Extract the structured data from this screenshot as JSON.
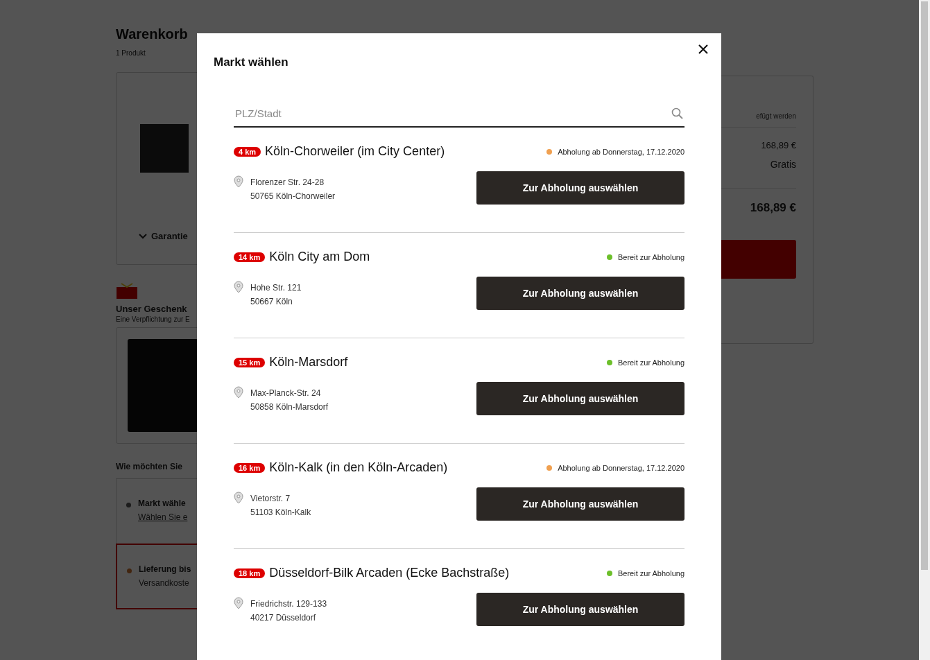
{
  "page": {
    "title": "Warenkorb",
    "subtitle": "1 Produkt",
    "warranty_toggle": "Garantie",
    "gift_title": "Unser Geschenk",
    "gift_text": "Eine Verpflichtung zur E",
    "delivery_heading": "Wie möchten Sie",
    "delivery_options": [
      {
        "title": "Markt wähle",
        "subtitle": "Wählen Sie e",
        "selected": false
      },
      {
        "title": "Lieferung bis",
        "subtitle": "Versandkoste",
        "selected": true
      }
    ],
    "summary": {
      "note": "efügt werden",
      "subtotal": "168,89 €",
      "shipping": "Gratis",
      "total": "168,89 €"
    }
  },
  "modal": {
    "title": "Markt wählen",
    "search": {
      "placeholder": "PLZ/Stadt"
    },
    "stores": [
      {
        "distance": "4 km",
        "name": "Köln-Chorweiler (im City Center)",
        "status": "Abholung ab Donnerstag, 17.12.2020",
        "color": "#f0a050",
        "street": "Florenzer Str. 24-28",
        "city": "50765 Köln-Chorweiler",
        "button": "Zur Abholung auswählen"
      },
      {
        "distance": "14 km",
        "name": "Köln City am Dom",
        "status": "Bereit zur Abholung",
        "color": "#6cbf2a",
        "street": "Hohe Str. 121",
        "city": "50667 Köln",
        "button": "Zur Abholung auswählen"
      },
      {
        "distance": "15 km",
        "name": "Köln-Marsdorf",
        "status": "Bereit zur Abholung",
        "color": "#6cbf2a",
        "street": "Max-Planck-Str. 24",
        "city": "50858 Köln-Marsdorf",
        "button": "Zur Abholung auswählen"
      },
      {
        "distance": "16 km",
        "name": "Köln-Kalk (in den Köln-Arcaden)",
        "status": "Abholung ab Donnerstag, 17.12.2020",
        "color": "#f0a050",
        "street": "Vietorstr. 7",
        "city": "51103 Köln-Kalk",
        "button": "Zur Abholung auswählen"
      },
      {
        "distance": "18 km",
        "name": "Düsseldorf-Bilk Arcaden (Ecke Bachstraße)",
        "status": "Bereit zur Abholung",
        "color": "#6cbf2a",
        "street": "Friedrichstr. 129-133",
        "city": "40217 Düsseldorf",
        "button": "Zur Abholung auswählen"
      }
    ]
  }
}
